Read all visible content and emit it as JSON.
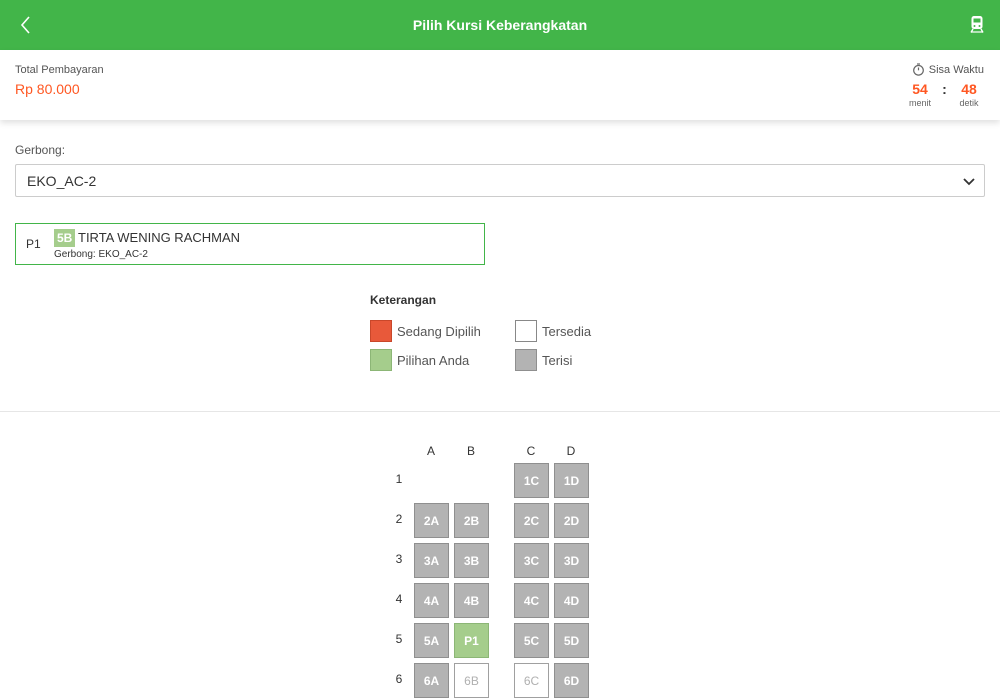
{
  "header": {
    "title": "Pilih Kursi Keberangkatan"
  },
  "payment": {
    "label": "Total Pembayaran",
    "amount": "Rp 80.000"
  },
  "timer": {
    "label": "Sisa Waktu",
    "minutes": "54",
    "minutes_label": "menit",
    "separator": ":",
    "seconds": "48",
    "seconds_label": "detik"
  },
  "car": {
    "label": "Gerbong:",
    "selected": "EKO_AC-2"
  },
  "passenger": {
    "code": "P1",
    "seat": "5B",
    "name": "TIRTA WENING RACHMAN",
    "car": "Gerbong: EKO_AC-2"
  },
  "legend": {
    "title": "Keterangan",
    "items": [
      {
        "label": "Sedang Dipilih",
        "color": "#e8593a"
      },
      {
        "label": "Tersedia",
        "color": "#ffffff"
      },
      {
        "label": "Pilihan Anda",
        "color": "#a5cd8c"
      },
      {
        "label": "Terisi",
        "color": "#b3b3b3"
      }
    ]
  },
  "seat_map": {
    "columns": [
      "A",
      "B",
      "C",
      "D"
    ],
    "rows": [
      {
        "label": "1",
        "seats": [
          null,
          null,
          {
            "label": "1C",
            "status": "terisi"
          },
          {
            "label": "1D",
            "status": "terisi"
          }
        ]
      },
      {
        "label": "2",
        "seats": [
          {
            "label": "2A",
            "status": "terisi"
          },
          {
            "label": "2B",
            "status": "terisi"
          },
          {
            "label": "2C",
            "status": "terisi"
          },
          {
            "label": "2D",
            "status": "terisi"
          }
        ]
      },
      {
        "label": "3",
        "seats": [
          {
            "label": "3A",
            "status": "terisi"
          },
          {
            "label": "3B",
            "status": "terisi"
          },
          {
            "label": "3C",
            "status": "terisi"
          },
          {
            "label": "3D",
            "status": "terisi"
          }
        ]
      },
      {
        "label": "4",
        "seats": [
          {
            "label": "4A",
            "status": "terisi"
          },
          {
            "label": "4B",
            "status": "terisi"
          },
          {
            "label": "4C",
            "status": "terisi"
          },
          {
            "label": "4D",
            "status": "terisi"
          }
        ]
      },
      {
        "label": "5",
        "seats": [
          {
            "label": "5A",
            "status": "terisi"
          },
          {
            "label": "P1",
            "status": "pilihan"
          },
          {
            "label": "5C",
            "status": "terisi"
          },
          {
            "label": "5D",
            "status": "terisi"
          }
        ]
      },
      {
        "label": "6",
        "seats": [
          {
            "label": "6A",
            "status": "terisi"
          },
          {
            "label": "6B",
            "status": "tersedia"
          },
          {
            "label": "6C",
            "status": "tersedia"
          },
          {
            "label": "6D",
            "status": "terisi"
          }
        ]
      }
    ]
  },
  "colors": {
    "brand": "#42b549",
    "accent": "#ff5722"
  }
}
